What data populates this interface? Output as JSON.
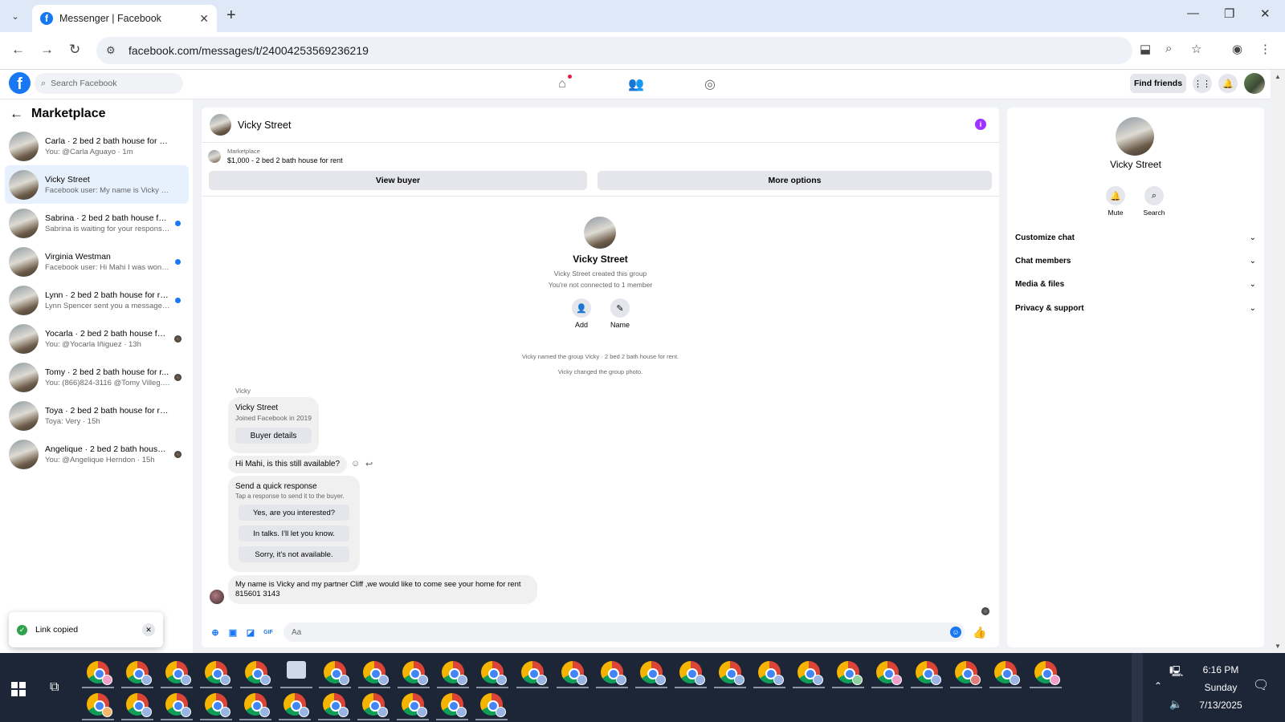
{
  "browser": {
    "tab_title": "Messenger | Facebook",
    "url": "facebook.com/messages/t/24004253569236219"
  },
  "fb_header": {
    "search_placeholder": "Search Facebook",
    "find_friends": "Find friends"
  },
  "sidebar": {
    "title": "Marketplace",
    "conversations": [
      {
        "name": "Carla · 2 bed 2 bath house for rent",
        "preview": "You: @Carla Aguayo · 1m",
        "status": "none"
      },
      {
        "name": "Vicky Street",
        "preview": "Facebook user: My name is Vicky and ... · 1h",
        "status": "active"
      },
      {
        "name": "Sabrina · 2 bed 2 bath house for ...",
        "preview": "Sabrina is waiting for your response. · 2h",
        "status": "unread"
      },
      {
        "name": "Virginia Westman",
        "preview": "Facebook user: Hi Mahi I was won... · 2h",
        "status": "unread"
      },
      {
        "name": "Lynn · 2 bed 2 bath house for rent",
        "preview": "Lynn Spencer sent you a message ... · 4h",
        "status": "unread"
      },
      {
        "name": "Yocarla · 2 bed 2 bath house for ...",
        "preview": "You: @Yocarla Iñiguez · 13h",
        "status": "seen"
      },
      {
        "name": "Tomy · 2 bed 2 bath house for r...",
        "preview": "You: (866)824-3116 @Tomy Villeg... · 13h",
        "status": "seen"
      },
      {
        "name": "Toya · 2 bed 2 bath house for rent",
        "preview": "Toya: Very · 15h",
        "status": "none"
      },
      {
        "name": "Angelique · 2 bed 2 bath house ...",
        "preview": "You: @Angelique Herndon · 15h",
        "status": "seen"
      }
    ]
  },
  "toast": {
    "message": "Link copied"
  },
  "chat": {
    "header_name": "Vicky Street",
    "listing_caption": "Marketplace",
    "listing_price": "$1,000 - 2 bed 2 bath house for rent",
    "view_buyer": "View buyer",
    "more_options": "More options",
    "group_name": "Vicky Street",
    "created_text": "Vicky Street created this group",
    "connected_text": "You're not connected to 1 member",
    "add_label": "Add",
    "name_label": "Name",
    "event1": "Vicky named the group Vicky · 2 bed 2 bath house for rent.",
    "event2": "Vicky changed the group photo.",
    "sender": "Vicky",
    "card_name": "Vicky Street",
    "card_joined": "Joined Facebook in 2019",
    "card_button": "Buyer details",
    "msg_hi": "Hi Mahi, is this still available?",
    "quick_title": "Send a quick response",
    "quick_sub": "Tap a response to send it to the buyer.",
    "quick_responses": [
      "Yes, are you interested?",
      "In talks. I'll let you know.",
      "Sorry, it's not available."
    ],
    "msg_long_1": "My name is Vicky and my partner Cliff ,we would like to come see your home for rent",
    "msg_long_2": "815601 3143",
    "composer_placeholder": "Aa"
  },
  "right_panel": {
    "name": "Vicky Street",
    "mute": "Mute",
    "search": "Search",
    "sections": [
      "Customize chat",
      "Chat members",
      "Media & files",
      "Privacy & support"
    ]
  },
  "taskbar": {
    "time": "6:16 PM",
    "day": "Sunday",
    "date": "7/13/2025"
  }
}
